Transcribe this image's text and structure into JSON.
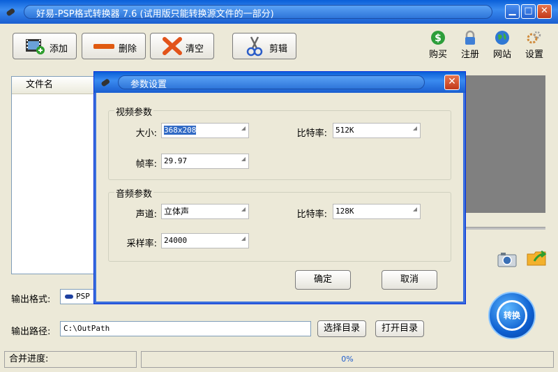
{
  "window": {
    "title": "好易-PSP格式转换器 7.6 (试用版只能转换源文件的一部分)",
    "min_glyph": "▁",
    "max_glyph": "□",
    "close_glyph": "✕"
  },
  "toolbar": {
    "add_label": "添加",
    "delete_label": "删除",
    "clear_label": "清空",
    "cut_label": "剪辑"
  },
  "right_icons": {
    "buy": "购买",
    "register": "注册",
    "website": "网站",
    "settings": "设置"
  },
  "file_list": {
    "header": "文件名"
  },
  "output": {
    "format_label": "输出格式:",
    "format_value": "PSP",
    "path_label": "输出路径:",
    "path_value": "C:\\OutPath",
    "choose_dir": "选择目录",
    "open_dir": "打开目录"
  },
  "convert_label": "转换",
  "status": {
    "merge_label": "合并进度:",
    "progress_text": "0%"
  },
  "dialog": {
    "title": "参数设置",
    "close_glyph": "✕",
    "video": {
      "group": "视频参数",
      "size_label": "大小:",
      "size_value": "368x208",
      "bitrate_label": "比特率:",
      "bitrate_value": "512K",
      "fps_label": "帧率:",
      "fps_value": "29.97"
    },
    "audio": {
      "group": "音频参数",
      "channel_label": "声道:",
      "channel_value": "立体声",
      "bitrate_label": "比特率:",
      "bitrate_value": "128K",
      "samplerate_label": "采样率:",
      "samplerate_value": "24000"
    },
    "ok": "确定",
    "cancel": "取消"
  },
  "colors": {
    "titlebar": "#0a5fd8",
    "window_bg": "#ece9d8",
    "close_red": "#c2391a",
    "preview_gray": "#808080",
    "selection": "#316ac5"
  }
}
